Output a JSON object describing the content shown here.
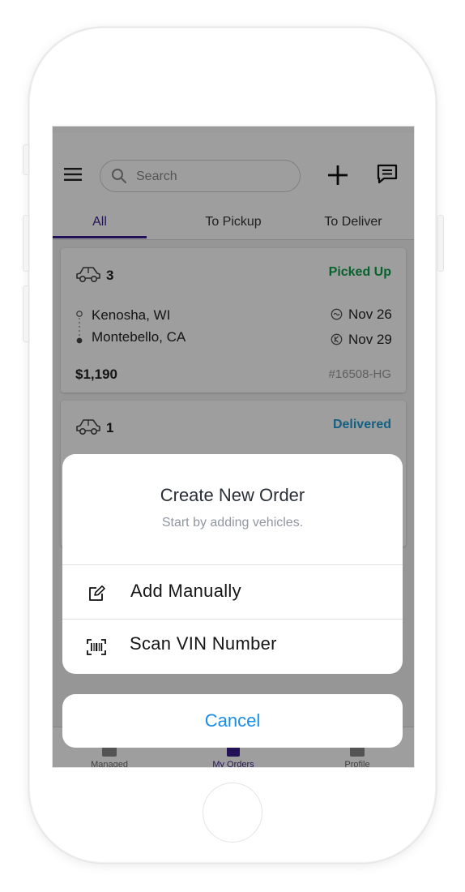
{
  "header": {
    "search_placeholder": "Search",
    "icons": [
      "menu-icon",
      "search-icon",
      "add-icon",
      "chat-icon"
    ]
  },
  "tabs": [
    {
      "label": "All",
      "active": true
    },
    {
      "label": "To Pickup",
      "active": false
    },
    {
      "label": "To Deliver",
      "active": false
    }
  ],
  "orders": [
    {
      "vehicle_count": "3",
      "status": "Picked Up",
      "status_color": "#0e9f4a",
      "origin": "Kenosha, WI",
      "destination": "Montebello, CA",
      "pickup_date": "Nov 26",
      "delivery_date": "Nov 29",
      "price": "$1,190",
      "order_id": "#16508-HG"
    },
    {
      "vehicle_count": "1",
      "status": "Delivered",
      "status_color": "#1f9bd1"
    }
  ],
  "bottom_nav": [
    {
      "label": "Managed",
      "active": false
    },
    {
      "label": "My Orders",
      "active": true
    },
    {
      "label": "Profile",
      "active": false
    }
  ],
  "sheet": {
    "title": "Create New Order",
    "subtitle": "Start by adding vehicles.",
    "actions": [
      {
        "label": "Add Manually",
        "icon": "edit-icon"
      },
      {
        "label": "Scan VIN Number",
        "icon": "barcode-scan-icon"
      }
    ],
    "cancel_label": "Cancel"
  },
  "colors": {
    "accent": "#3a1d8f",
    "link": "#1a8de6",
    "overlay": "rgba(0,0,0,0.38)"
  }
}
